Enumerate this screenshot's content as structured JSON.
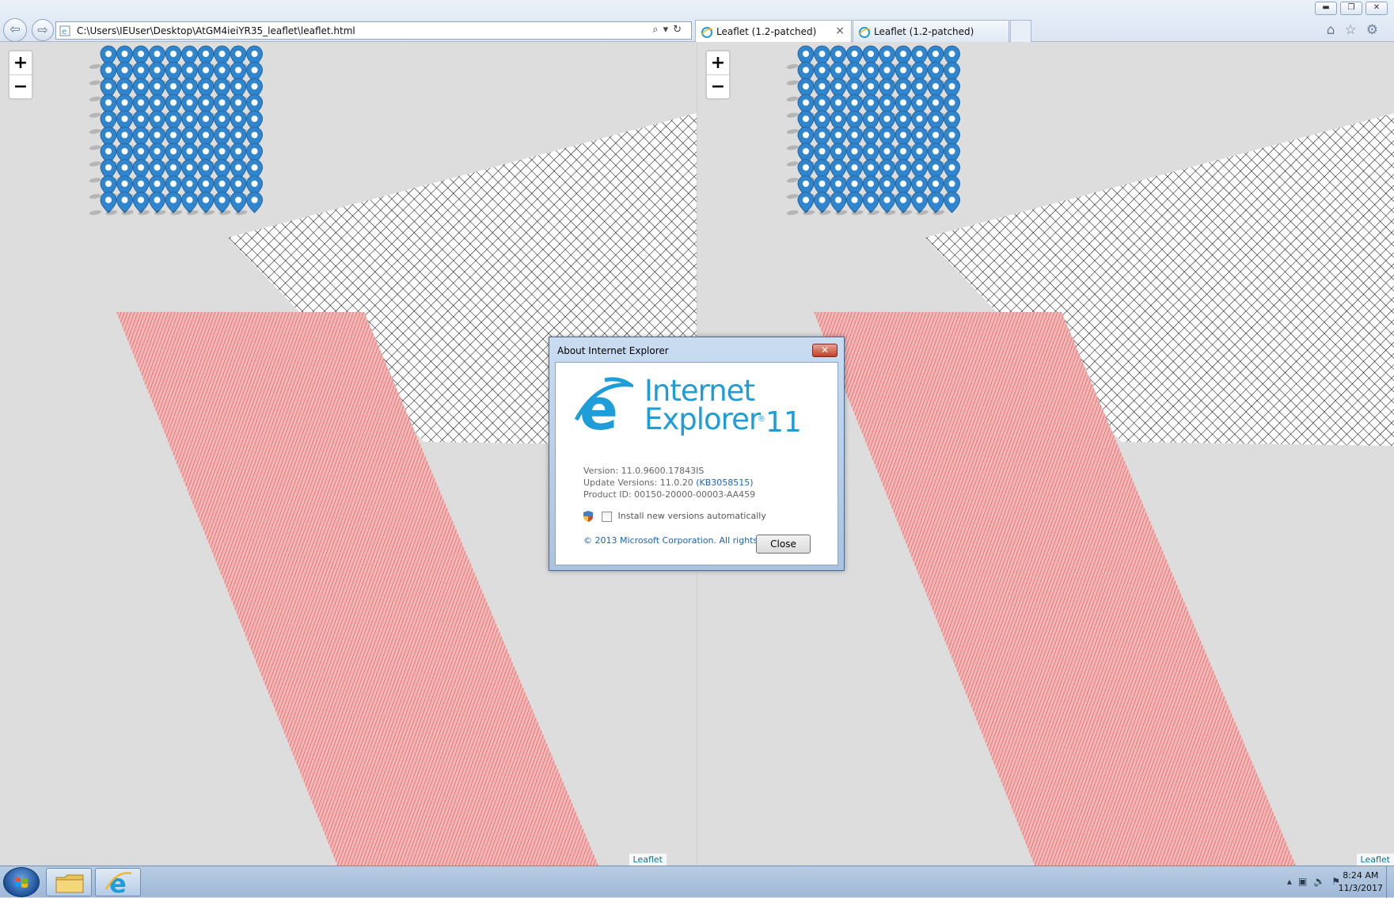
{
  "browser": {
    "address": "C:\\Users\\IEUser\\Desktop\\AtGM4ieiYR35_leaflet\\leaflet.html",
    "tabs": [
      {
        "label": "Leaflet (1.2-patched)",
        "active": true
      },
      {
        "label": "Leaflet (1.2-patched)",
        "active": false
      }
    ]
  },
  "map": {
    "zoom_in": "+",
    "zoom_out": "−",
    "attribution": "Leaflet",
    "marker_grid": {
      "columns": 10,
      "rows": 10
    },
    "marker_color": "#2f86cf",
    "stripe_color": "#e04c4c",
    "grid_color": "#000000"
  },
  "dialog": {
    "title": "About Internet Explorer",
    "product_line1": "Internet",
    "product_line2": "Explorer",
    "product_version": "11",
    "version": "Version: 11.0.9600.17843IS",
    "update_versions": "Update Versions: 11.0.20",
    "kb": "(KB3058515)",
    "product_id": "Product ID: 00150-20000-00003-AA459",
    "auto_update_label": "Install new versions automatically",
    "copyright": "© 2013 Microsoft Corporation. All rights reserved.",
    "close_button": "Close"
  },
  "taskbar": {
    "time": "8:24 AM",
    "date": "11/3/2017"
  }
}
